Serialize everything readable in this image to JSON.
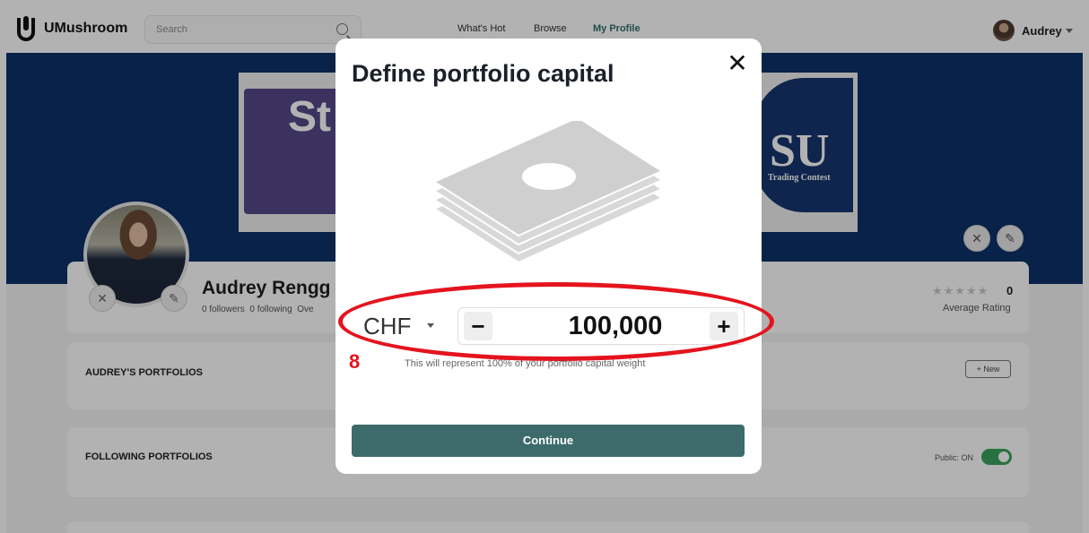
{
  "nav": {
    "logo": "UMushroom",
    "search_placeholder": "Search",
    "links": [
      "What's Hot",
      "Browse",
      "My Profile"
    ],
    "active_link": "My Profile",
    "user_name": "Audrey"
  },
  "banner": {
    "left_text": "St",
    "seal_text": "SU",
    "seal_subtitle": "Trading Contest"
  },
  "profile": {
    "name": "Audrey Rengg",
    "followers": "0 followers",
    "following": "0 following",
    "extra": "Ove",
    "rating_stars": 0,
    "rating_value": "0",
    "rating_label": "Average Rating"
  },
  "sections": {
    "portfolios_title": "AUDREY'S PORTFOLIOS",
    "new_button": "New",
    "following_title": "FOLLOWING PORTFOLIOS",
    "public_label": "Public: ON",
    "public_on": true
  },
  "modal": {
    "title": "Define portfolio capital",
    "currency": "CHF",
    "amount": "100,000",
    "minus_label": "−",
    "plus_label": "+",
    "hint": "This will represent 100% of your portfolio capital weight",
    "continue_label": "Continue",
    "close_label": "✕"
  },
  "annotation": {
    "number": "8",
    "color": "#e4141e"
  },
  "colors": {
    "banner": "#0c3169",
    "primary_button": "#3d6b6b",
    "active_nav": "#2f6f6a",
    "toggle_on": "#3aa45d"
  }
}
